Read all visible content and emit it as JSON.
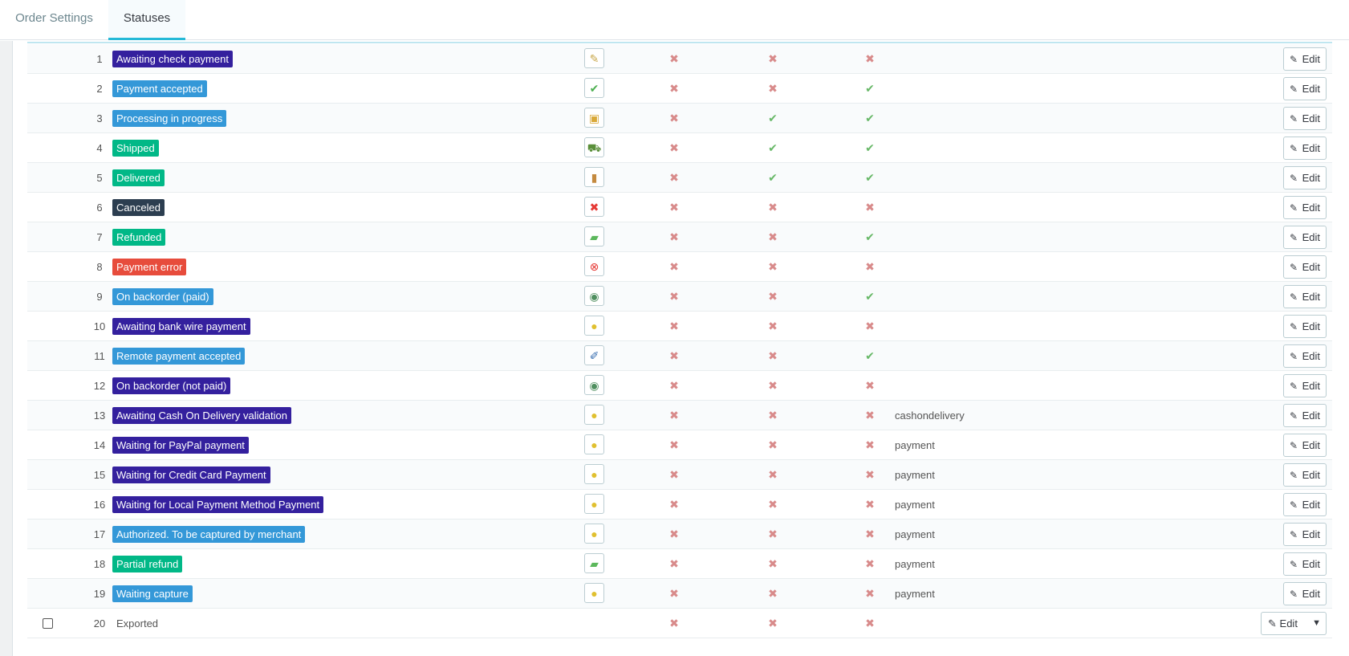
{
  "tabs": [
    "Order Settings",
    "Statuses"
  ],
  "edit_label": "Edit",
  "colors": {
    "purple": "#34209e",
    "blue": "#3498d8",
    "green": "#01b887",
    "dark": "#2c3e50",
    "red": "#e74c3c",
    "check": "#68b868",
    "cross": "#d88a8a"
  },
  "rows": [
    {
      "id": "1",
      "name": "Awaiting check payment",
      "color": "purple",
      "icon": "✎",
      "icon_name": "cheque-icon",
      "icon_color": "#c9a84c",
      "f1": "x",
      "f2": "x",
      "f3": "x",
      "template": ""
    },
    {
      "id": "2",
      "name": "Payment accepted",
      "color": "blue",
      "icon": "✔",
      "icon_name": "check-icon",
      "icon_color": "#4caf50",
      "f1": "x",
      "f2": "x",
      "f3": "v",
      "template": ""
    },
    {
      "id": "3",
      "name": "Processing in progress",
      "color": "blue",
      "icon": "▣",
      "icon_name": "package-icon",
      "icon_color": "#d9a93a",
      "f1": "x",
      "f2": "v",
      "f3": "v",
      "template": ""
    },
    {
      "id": "4",
      "name": "Shipped",
      "color": "green",
      "icon": "⛟",
      "icon_name": "truck-icon",
      "icon_color": "#5a8f3a",
      "f1": "x",
      "f2": "v",
      "f3": "v",
      "template": ""
    },
    {
      "id": "5",
      "name": "Delivered",
      "color": "green",
      "icon": "▮",
      "icon_name": "door-icon",
      "icon_color": "#c48a3f",
      "f1": "x",
      "f2": "v",
      "f3": "v",
      "template": ""
    },
    {
      "id": "6",
      "name": "Canceled",
      "color": "dark",
      "icon": "✖",
      "icon_name": "cancel-icon",
      "icon_color": "#e53935",
      "f1": "x",
      "f2": "x",
      "f3": "x",
      "template": ""
    },
    {
      "id": "7",
      "name": "Refunded",
      "color": "green",
      "icon": "▰",
      "icon_name": "money-icon",
      "icon_color": "#5cb85c",
      "f1": "x",
      "f2": "x",
      "f3": "v",
      "template": ""
    },
    {
      "id": "8",
      "name": "Payment error",
      "color": "red",
      "icon": "⊗",
      "icon_name": "error-icon",
      "icon_color": "#e53935",
      "f1": "x",
      "f2": "x",
      "f3": "x",
      "template": ""
    },
    {
      "id": "9",
      "name": "On backorder (paid)",
      "color": "blue",
      "icon": "◉",
      "icon_name": "clock-icon",
      "icon_color": "#4f8f5f",
      "f1": "x",
      "f2": "x",
      "f3": "v",
      "template": ""
    },
    {
      "id": "10",
      "name": "Awaiting bank wire payment",
      "color": "purple",
      "icon": "●",
      "icon_name": "coins-icon",
      "icon_color": "#e0c030",
      "f1": "x",
      "f2": "x",
      "f3": "x",
      "template": ""
    },
    {
      "id": "11",
      "name": "Remote payment accepted",
      "color": "blue",
      "icon": "✐",
      "icon_name": "plug-icon",
      "icon_color": "#3a6fb0",
      "f1": "x",
      "f2": "x",
      "f3": "v",
      "template": ""
    },
    {
      "id": "12",
      "name": "On backorder (not paid)",
      "color": "purple",
      "icon": "◉",
      "icon_name": "clock-icon",
      "icon_color": "#4f8f5f",
      "f1": "x",
      "f2": "x",
      "f3": "x",
      "template": ""
    },
    {
      "id": "13",
      "name": "Awaiting Cash On Delivery validation",
      "color": "purple",
      "icon": "●",
      "icon_name": "coins-icon",
      "icon_color": "#e0c030",
      "f1": "x",
      "f2": "x",
      "f3": "x",
      "template": "cashondelivery"
    },
    {
      "id": "14",
      "name": "Waiting for PayPal payment",
      "color": "purple",
      "icon": "●",
      "icon_name": "coins-icon",
      "icon_color": "#e0c030",
      "f1": "x",
      "f2": "x",
      "f3": "x",
      "template": "payment"
    },
    {
      "id": "15",
      "name": "Waiting for Credit Card Payment",
      "color": "purple",
      "icon": "●",
      "icon_name": "coins-icon",
      "icon_color": "#e0c030",
      "f1": "x",
      "f2": "x",
      "f3": "x",
      "template": "payment"
    },
    {
      "id": "16",
      "name": "Waiting for Local Payment Method Payment",
      "color": "purple",
      "icon": "●",
      "icon_name": "coins-icon",
      "icon_color": "#e0c030",
      "f1": "x",
      "f2": "x",
      "f3": "x",
      "template": "payment"
    },
    {
      "id": "17",
      "name": "Authorized. To be captured by merchant",
      "color": "blue",
      "icon": "●",
      "icon_name": "coins-icon",
      "icon_color": "#e0c030",
      "f1": "x",
      "f2": "x",
      "f3": "x",
      "template": "payment"
    },
    {
      "id": "18",
      "name": "Partial refund",
      "color": "green",
      "icon": "▰",
      "icon_name": "money-icon",
      "icon_color": "#5cb85c",
      "f1": "x",
      "f2": "x",
      "f3": "x",
      "template": "payment"
    },
    {
      "id": "19",
      "name": "Waiting capture",
      "color": "blue",
      "icon": "●",
      "icon_name": "coins-icon",
      "icon_color": "#e0c030",
      "f1": "x",
      "f2": "x",
      "f3": "x",
      "template": "payment"
    },
    {
      "id": "20",
      "name": "Exported",
      "color": "",
      "icon": "",
      "icon_name": "",
      "icon_color": "",
      "f1": "x",
      "f2": "x",
      "f3": "x",
      "template": "",
      "checkbox": true,
      "dropdown": true
    }
  ]
}
